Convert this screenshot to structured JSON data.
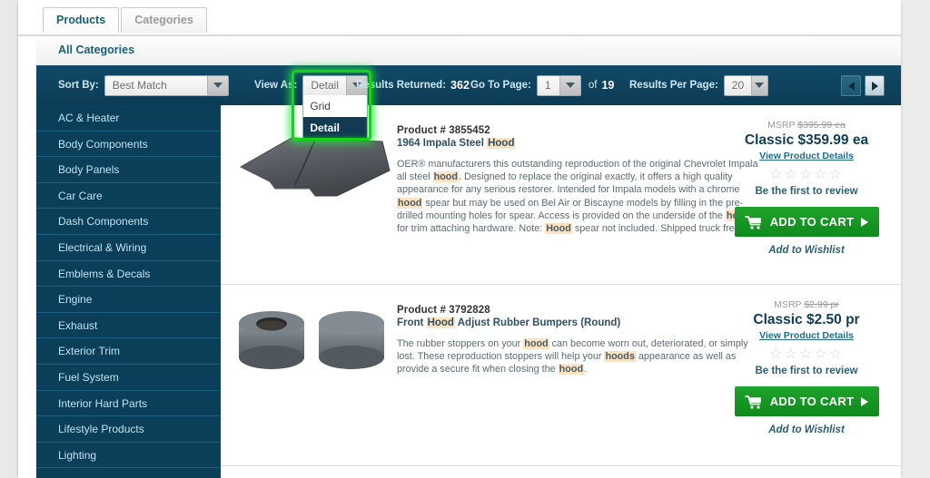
{
  "tabs": [
    {
      "label": "Products",
      "active": true
    },
    {
      "label": "Categories",
      "active": false
    }
  ],
  "breadcrumb": {
    "label": "All Categories"
  },
  "toolbar": {
    "sort_by_label": "Sort By:",
    "sort_by_value": "Best Match",
    "view_as_label": "View As:",
    "view_as_value": "Detail",
    "view_as_options": [
      "Grid",
      "Detail"
    ],
    "view_as_selected": "Detail",
    "results_returned_label": "Results Returned:",
    "results_returned_value": "362",
    "go_to_page_label": "Go To Page:",
    "go_to_page_value": "1",
    "of_label": "of",
    "total_pages": "19",
    "results_per_page_label": "Results Per Page:",
    "results_per_page_value": "20",
    "prev_icon": "left-arrow-icon",
    "next_icon": "right-arrow-icon"
  },
  "sidebar": {
    "items": [
      {
        "label": "AC & Heater"
      },
      {
        "label": "Body Components"
      },
      {
        "label": "Body Panels"
      },
      {
        "label": "Car Care"
      },
      {
        "label": "Dash Components"
      },
      {
        "label": "Electrical & Wiring"
      },
      {
        "label": "Emblems & Decals"
      },
      {
        "label": "Engine"
      },
      {
        "label": "Exhaust"
      },
      {
        "label": "Exterior Trim"
      },
      {
        "label": "Fuel System"
      },
      {
        "label": "Interior Hard Parts"
      },
      {
        "label": "Lifestyle Products"
      },
      {
        "label": "Lighting"
      }
    ]
  },
  "products": [
    {
      "product_number": "Product # 3855452",
      "name_parts": [
        {
          "t": "1964 Impala Steel ",
          "hl": false
        },
        {
          "t": "Hood",
          "hl": true
        }
      ],
      "desc_parts": [
        {
          "t": "OER® manufacturers this outstanding reproduction of the original Chevrolet Impala all steel ",
          "hl": false
        },
        {
          "t": "hood",
          "hl": true
        },
        {
          "t": ". Designed to replace the original exactly, it offers a high quality appearance for any serious restorer. Intended for Impala models with a chrome ",
          "hl": false
        },
        {
          "t": "hood",
          "hl": true
        },
        {
          "t": " spear but may be used on Bel Air or Biscayne models by filling in the pre-drilled mounting holes for spear. Access is provided on the underside of the ",
          "hl": false
        },
        {
          "t": "hood",
          "hl": true
        },
        {
          "t": " for trim attaching hardware. Note: ",
          "hl": false
        },
        {
          "t": "Hood",
          "hl": true
        },
        {
          "t": " spear not included. Shipped truck freight.",
          "hl": false
        }
      ],
      "msrp_label": "MSRP",
      "msrp_value": "$395.99 ea",
      "price": "Classic $359.99 ea",
      "details_link": "View Product Details",
      "stars": "☆☆☆☆☆",
      "review_text": "Be the first to review",
      "cart_label": "ADD TO CART",
      "wishlist_label": "Add to Wishlist",
      "image": "car-hood-image"
    },
    {
      "product_number": "Product # 3792828",
      "name_parts": [
        {
          "t": "Front ",
          "hl": false
        },
        {
          "t": "Hood",
          "hl": true
        },
        {
          "t": " Adjust Rubber Bumpers (Round)",
          "hl": false
        }
      ],
      "desc_parts": [
        {
          "t": "The rubber stoppers on your ",
          "hl": false
        },
        {
          "t": "hood",
          "hl": true
        },
        {
          "t": " can become worn out, deteriorated, or simply lost. These reproduction stoppers will help your ",
          "hl": false
        },
        {
          "t": "hoods",
          "hl": true
        },
        {
          "t": " appearance as well as provide a secure fit when closing the ",
          "hl": false
        },
        {
          "t": "hood",
          "hl": true
        },
        {
          "t": ".",
          "hl": false
        }
      ],
      "msrp_label": "MSRP",
      "msrp_value": "$2.99 pr",
      "price": "Classic $2.50 pr",
      "details_link": "View Product Details",
      "stars": "☆☆☆☆☆",
      "review_text": "Be the first to review",
      "cart_label": "ADD TO CART",
      "wishlist_label": "Add to Wishlist",
      "image": "rubber-bumpers-image"
    }
  ],
  "colors": {
    "toolbar_bg": "#0d4a6b",
    "sidebar_bg": "#0b3e59",
    "accent_link": "#1d6b86",
    "cart_green": "#1a9e26",
    "highlight_green": "#15d215",
    "term_highlight": "#fbe2c0"
  }
}
